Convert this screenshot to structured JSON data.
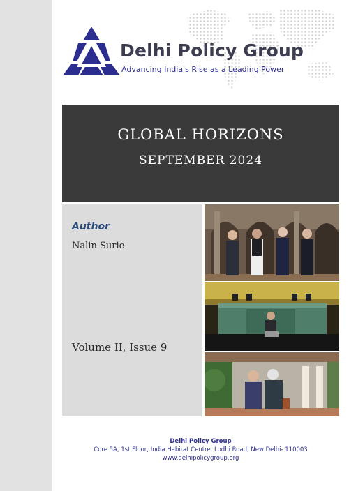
{
  "header": {
    "org_name": "Delhi Policy Group",
    "tagline": "Advancing India's Rise as a Leading Power",
    "logo_icon": "delhi-policy-group-logo",
    "brand_color": "#2c2e8f"
  },
  "title": {
    "main": "GLOBAL HORIZONS",
    "sub": "SEPTEMBER 2024"
  },
  "author": {
    "label": "Author",
    "name": "Nalin Surie"
  },
  "issue": {
    "volume": "Volume II, Issue 9"
  },
  "footer": {
    "name": "Delhi Policy Group",
    "address": "Core 5A, 1st Floor, India Habitat Centre, Lodhi Road, New Delhi- 110003",
    "website": "www.delhipolicygroup.org"
  },
  "colors": {
    "banner": "#3a3a3a",
    "author_panel": "#dcdcdc",
    "author_label": "#2c4a7a"
  }
}
